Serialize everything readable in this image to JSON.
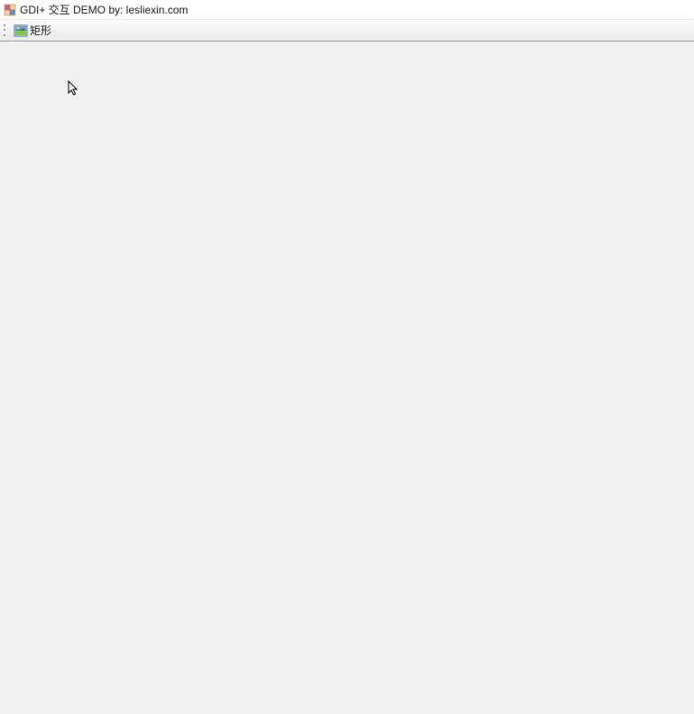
{
  "window": {
    "title": "GDI+ 交互 DEMO  by: lesliexin.com"
  },
  "toolbar": {
    "rectangle_button": {
      "label": "矩形",
      "icon": "image-icon"
    }
  }
}
